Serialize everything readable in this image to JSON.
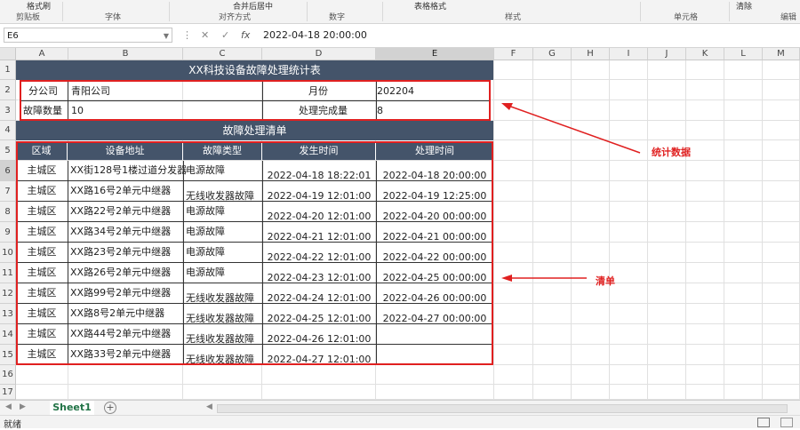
{
  "ribbon": {
    "format_painter": "格式刷",
    "groups": [
      "剪贴板",
      "字体",
      "对齐方式",
      "数字",
      "样式",
      "单元格",
      "编辑"
    ],
    "table_format": "表格格式",
    "merge_center": "合并后居中",
    "clear": "清除"
  },
  "formula_bar": {
    "name_box": "E6",
    "cancel": "✕",
    "enter": "✓",
    "fx": "fx",
    "value": "2022-04-18  20:00:00"
  },
  "columns": [
    "A",
    "B",
    "C",
    "D",
    "E",
    "F",
    "G",
    "H",
    "I",
    "J",
    "K",
    "L",
    "M"
  ],
  "rows": [
    "1",
    "2",
    "3",
    "4",
    "5",
    "6",
    "7",
    "8",
    "9",
    "10",
    "11",
    "12",
    "13",
    "14",
    "15",
    "16",
    "17"
  ],
  "sheet": {
    "title": "XX科技设备故障处理统计表",
    "info": {
      "branch_label": "分公司",
      "branch_value": "青阳公司",
      "month_label": "月份",
      "month_value": "202204",
      "fault_count_label": "故障数量",
      "fault_count_value": "10",
      "done_label": "处理完成量",
      "done_value": "8"
    },
    "list_title": "故障处理清单",
    "headers": [
      "区域",
      "设备地址",
      "故障类型",
      "发生时间",
      "处理时间"
    ],
    "records": [
      [
        "主城区",
        "XX街128号1楼过道分发器",
        "电源故障",
        "2022-04-18 18:22:01",
        "2022-04-18 20:00:00"
      ],
      [
        "主城区",
        "XX路16号2单元中继器",
        "无线收发器故障",
        "2022-04-19 12:01:00",
        "2022-04-19 12:25:00"
      ],
      [
        "主城区",
        "XX路22号2单元中继器",
        "电源故障",
        "2022-04-20 12:01:00",
        "2022-04-20 00:00:00"
      ],
      [
        "主城区",
        "XX路34号2单元中继器",
        "电源故障",
        "2022-04-21 12:01:00",
        "2022-04-21 00:00:00"
      ],
      [
        "主城区",
        "XX路23号2单元中继器",
        "电源故障",
        "2022-04-22 12:01:00",
        "2022-04-22 00:00:00"
      ],
      [
        "主城区",
        "XX路26号2单元中继器",
        "电源故障",
        "2022-04-23 12:01:00",
        "2022-04-25 00:00:00"
      ],
      [
        "主城区",
        "XX路99号2单元中继器",
        "无线收发器故障",
        "2022-04-24 12:01:00",
        "2022-04-26 00:00:00"
      ],
      [
        "主城区",
        "XX路8号2单元中继器",
        "无线收发器故障",
        "2022-04-25 12:01:00",
        "2022-04-27 00:00:00"
      ],
      [
        "主城区",
        "XX路44号2单元中继器",
        "无线收发器故障",
        "2022-04-26 12:01:00",
        ""
      ],
      [
        "主城区",
        "XX路33号2单元中继器",
        "无线收发器故障",
        "2022-04-27 12:01:00",
        ""
      ]
    ]
  },
  "annotations": {
    "stats_label": "统计数据",
    "list_label": "清单",
    "color": "#e02020"
  },
  "tabs": {
    "active": "Sheet1",
    "add": "+"
  },
  "status": {
    "text": "就绪"
  },
  "colors": {
    "header_fill": "#44546a",
    "tab_accent": "#217346"
  }
}
